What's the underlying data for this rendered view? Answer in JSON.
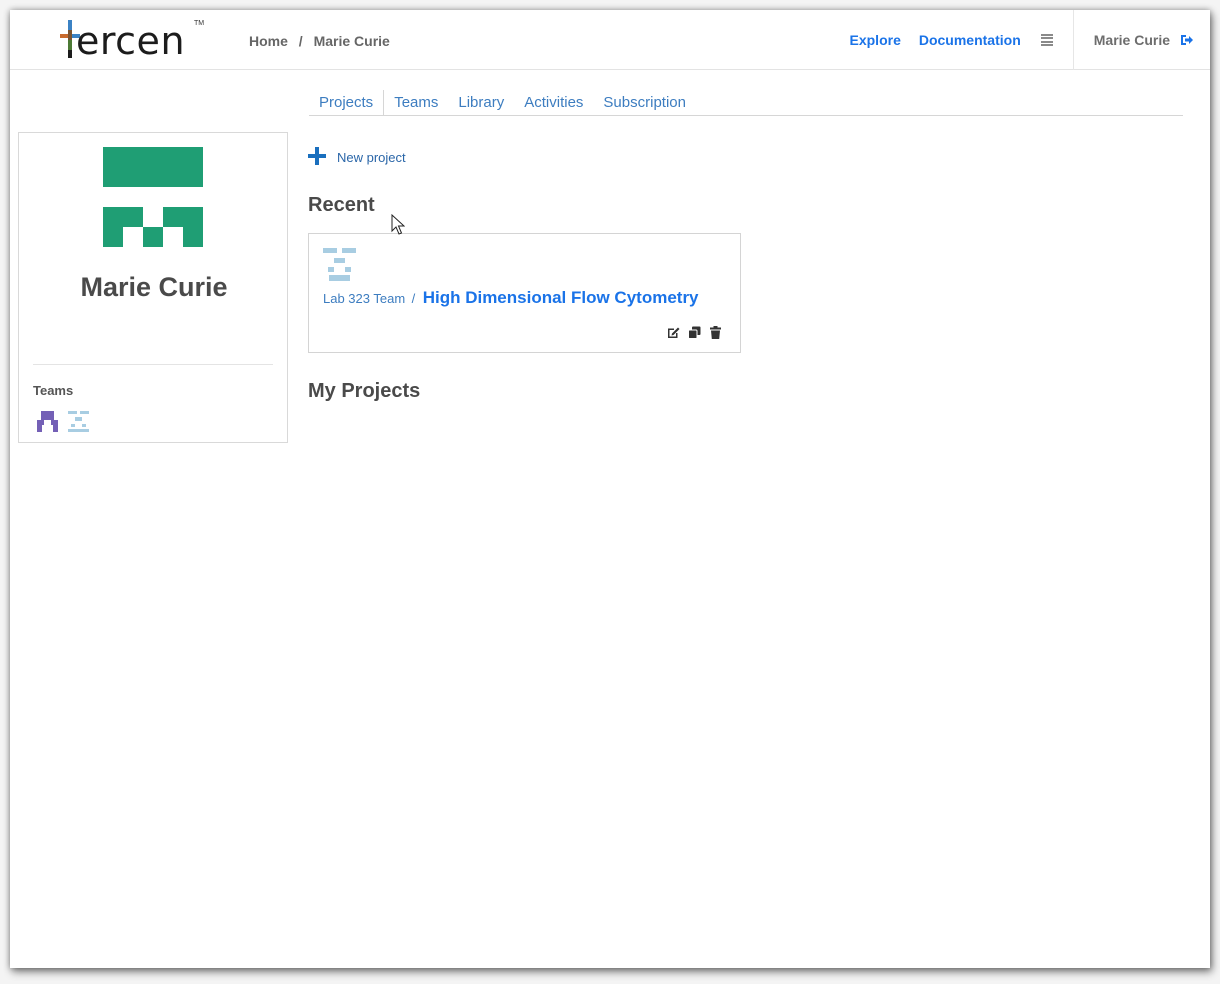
{
  "header": {
    "breadcrumb": [
      "Home",
      "Marie Curie"
    ],
    "breadcrumb_separator": "/",
    "nav_links": [
      "Explore",
      "Documentation"
    ],
    "menu_icon": "hamburger-icon",
    "user_name": "Marie Curie",
    "logout_icon": "sign-out-icon"
  },
  "logo": {
    "text": "ercen",
    "trademark": "TM",
    "colors": [
      "#3b82c4",
      "#7a5230",
      "#c96a2d",
      "#4c7a35",
      "#1c1c1c"
    ]
  },
  "tabs": [
    "Projects",
    "Teams",
    "Library",
    "Activities",
    "Subscription"
  ],
  "active_tab": "Projects",
  "profile": {
    "name": "Marie Curie",
    "avatar_color": "#1f9e74",
    "teams_title": "Teams",
    "team_icon_colors": [
      "#7460b6",
      "#a8cde2"
    ]
  },
  "main": {
    "new_project_label": "New project",
    "recent_title": "Recent",
    "my_projects_title": "My Projects",
    "recent_projects": [
      {
        "team": "Lab 323 Team",
        "separator": "/",
        "name": "High Dimensional Flow Cytometry",
        "avatar_color": "#a8cde2",
        "actions": [
          "edit-icon",
          "copy-icon",
          "trash-icon"
        ]
      }
    ]
  },
  "colors": {
    "link": "#1a73e8",
    "tab_link": "#3d7dc0",
    "heading": "#4a4a4a"
  }
}
